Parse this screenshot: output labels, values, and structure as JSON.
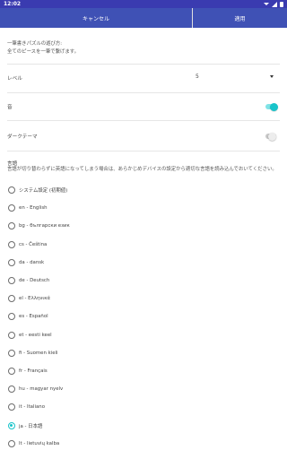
{
  "status_bar": {
    "time": "12:02"
  },
  "toolbar": {
    "cancel_label": "キャンセル",
    "apply_label": "適用"
  },
  "intro": {
    "line1": "一筆書きパズルの遊び方:",
    "line2": "全てのピースを一筆で繋げます。"
  },
  "settings": {
    "level_label": "レベル",
    "level_value": "5",
    "sound_label": "音",
    "sound_on": true,
    "dark_theme_label": "ダークテーマ",
    "dark_theme_on": false
  },
  "language": {
    "title": "言語",
    "description": "言語が切り替わらずに英語になってしまう場合は、あらかじめデバイスの設定から適切な言語を読み込んでおいてください。",
    "selected": "ja - 日本語",
    "options": [
      "システム設定 (初期値)",
      "en - English",
      "bg - български език",
      "cs - Čeština",
      "da - dansk",
      "de - Deutsch",
      "el - Ελληνικά",
      "es - Español",
      "et - eesti keel",
      "fi - Suomen kieli",
      "fr - Français",
      "hu - magyar nyelv",
      "it - Italiano",
      "ja - 日本語",
      "lt - lietuvių kalba"
    ]
  },
  "colors": {
    "primary": "#3f51b5",
    "status_bar": "#3a3bb0",
    "accent": "#18c4ca"
  }
}
